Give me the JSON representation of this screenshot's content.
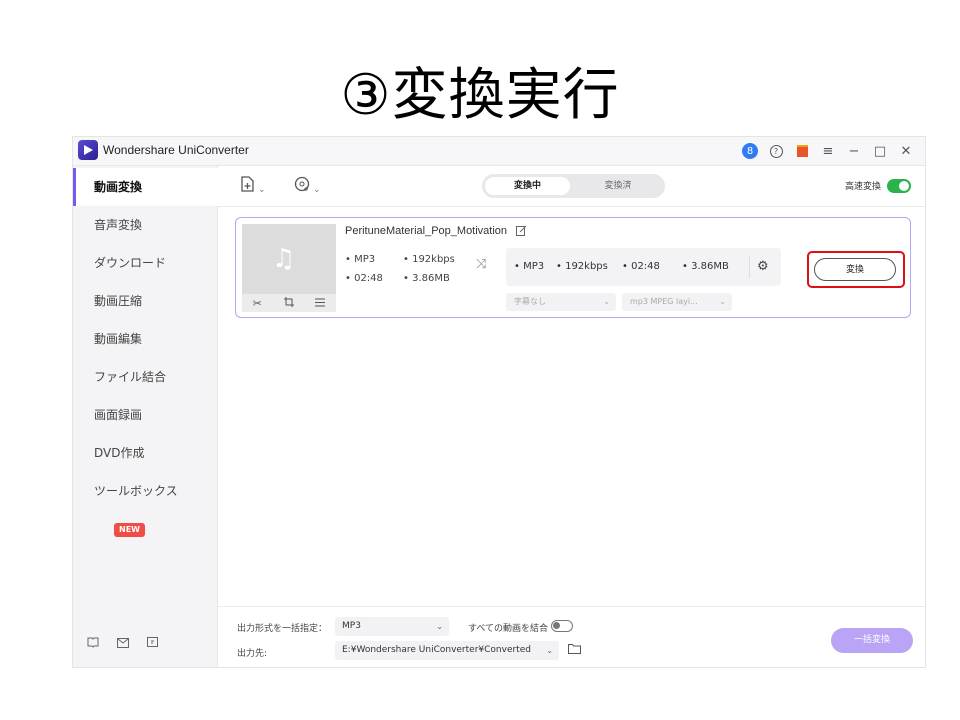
{
  "slide": {
    "title": "③変換実行"
  },
  "app": {
    "name": "Wondershare UniConverter"
  },
  "titlebar": {
    "icons": [
      "user-icon",
      "help-icon",
      "gift-icon",
      "menu-icon",
      "minimize-icon",
      "maximize-icon",
      "close-icon"
    ],
    "glyphs": {
      "help": "?",
      "gift": "🎁",
      "menu": "≡",
      "minimize": "−",
      "maximize": "□",
      "close": "✕",
      "user": "8"
    }
  },
  "sidebar": {
    "items": [
      {
        "label": "動画変換",
        "active": true
      },
      {
        "label": "音声変換"
      },
      {
        "label": "ダウンロード"
      },
      {
        "label": "動画圧縮"
      },
      {
        "label": "動画編集"
      },
      {
        "label": "ファイル結合"
      },
      {
        "label": "画面録画"
      },
      {
        "label": "DVD作成"
      },
      {
        "label": "ツールボックス",
        "badge": "NEW"
      }
    ],
    "bottom_icons": [
      "book-icon",
      "mail-icon",
      "feedback-icon"
    ]
  },
  "toolbar": {
    "tab_converting": "変換中",
    "tab_converted": "変換済",
    "high_speed_label": "高速変換",
    "high_speed_on": true
  },
  "file": {
    "name": "PerituneMaterial_Pop_Motivation",
    "source": {
      "format": "MP3",
      "bitrate": "192kbps",
      "duration": "02:48",
      "size": "3.86MB"
    },
    "output": {
      "format": "MP3",
      "bitrate": "192kbps",
      "duration": "02:48",
      "size": "3.86MB"
    },
    "subtitle": "字幕なし",
    "audio_track": "mp3 MPEG layi...",
    "convert_label": "変換"
  },
  "footer": {
    "output_format_label": "出力形式を一括指定：",
    "output_format_value": "MP3",
    "merge_label": "すべての動画を結合",
    "merge_on": false,
    "output_dest_label": "出力先:",
    "output_dest_value": "E:¥Wondershare UniConverter¥Converted",
    "convert_all_label": "一括変換"
  },
  "colors": {
    "accent": "#6f5cf0",
    "highlight_box": "#dd1111",
    "toggle_on": "#2bb24c",
    "convert_all": "#b9a4f5"
  }
}
